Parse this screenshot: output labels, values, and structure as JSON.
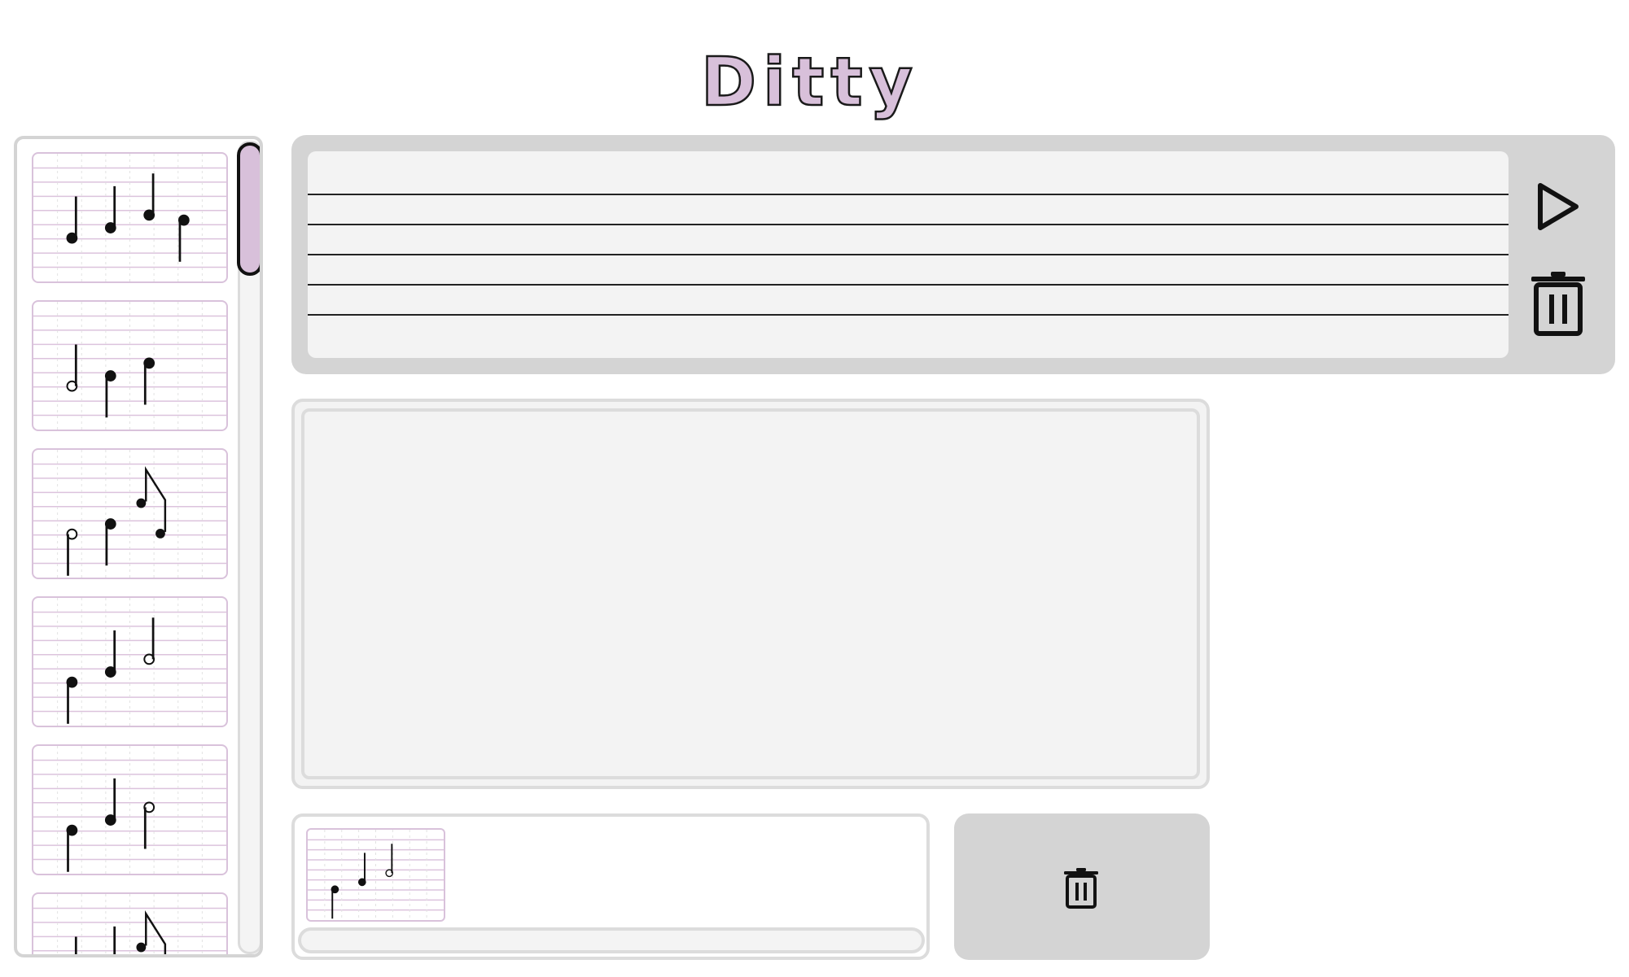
{
  "app": {
    "title": "Ditty"
  },
  "icons": {
    "play": "play-icon",
    "trash": "trash-icon"
  },
  "colors": {
    "accent": "#d8c0da",
    "panel": "#d4d4d4",
    "staff_bg": "#f3f3f3",
    "ink": "#111111"
  },
  "library": {
    "scroll_fraction": 0.0,
    "cards": [
      {
        "notes": [
          "quarter-down",
          "quarter-down",
          "quarter-down",
          "quarter-up"
        ]
      },
      {
        "notes": [
          "half-down",
          "quarter-up",
          "quarter-up"
        ]
      },
      {
        "notes": [
          "half-up",
          "quarter-up",
          "eighth-pair"
        ]
      },
      {
        "notes": [
          "quarter-up",
          "quarter-down",
          "half-down"
        ]
      },
      {
        "notes": [
          "quarter-up",
          "quarter-down",
          "half-up"
        ]
      },
      {
        "notes": [
          "quarter-down",
          "quarter-down",
          "eighth-pair"
        ]
      }
    ]
  },
  "sequence": {
    "items": [
      {
        "notes": [
          "quarter-up",
          "quarter-down",
          "half-down"
        ]
      }
    ]
  }
}
